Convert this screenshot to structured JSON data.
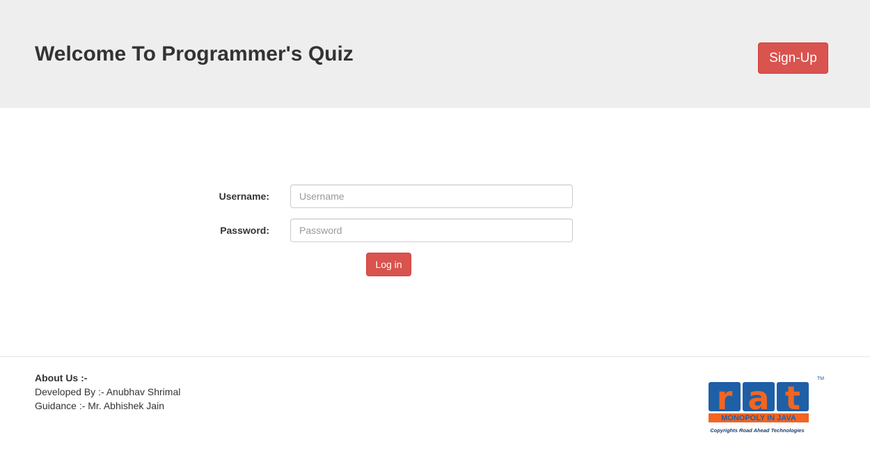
{
  "header": {
    "title": "Welcome To Programmer's Quiz",
    "signup_label": "Sign-Up"
  },
  "login_form": {
    "username_label": "Username:",
    "username_placeholder": "Username",
    "username_value": "",
    "password_label": "Password:",
    "password_placeholder": "Password",
    "password_value": "",
    "login_label": "Log in"
  },
  "footer": {
    "about_title": "About Us :-",
    "developed_by": "Developed By :- Anubhav Shrimal",
    "guidance": "Guidance :- Mr. Abhishek Jain",
    "logo": {
      "letters": [
        "r",
        "a",
        "t"
      ],
      "tagline": "MONOPOLY IN JAVA",
      "trademark": "TM",
      "copyright": "Copyrights Road Ahead Technologies"
    }
  },
  "colors": {
    "header_bg": "#eeeeee",
    "danger": "#d9534f",
    "logo_blue": "#1f5fa6",
    "logo_orange": "#f26522"
  }
}
